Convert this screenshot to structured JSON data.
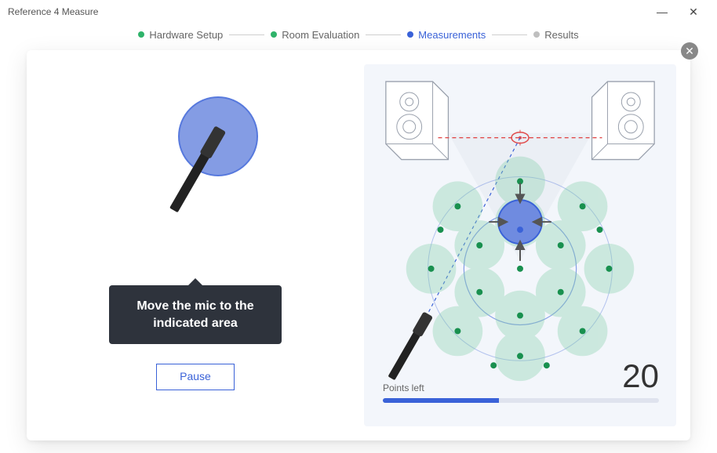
{
  "window": {
    "title": "Reference 4 Measure"
  },
  "stepper": {
    "steps": [
      {
        "label": "Hardware Setup",
        "state": "done"
      },
      {
        "label": "Room Evaluation",
        "state": "done"
      },
      {
        "label": "Measurements",
        "state": "active"
      },
      {
        "label": "Results",
        "state": "pending"
      }
    ]
  },
  "instruction": {
    "tooltip": "Move the mic to the indicated area",
    "pause_label": "Pause"
  },
  "measurement": {
    "points_left_label": "Points left",
    "points_left_value": "20",
    "progress_percent": 42
  }
}
